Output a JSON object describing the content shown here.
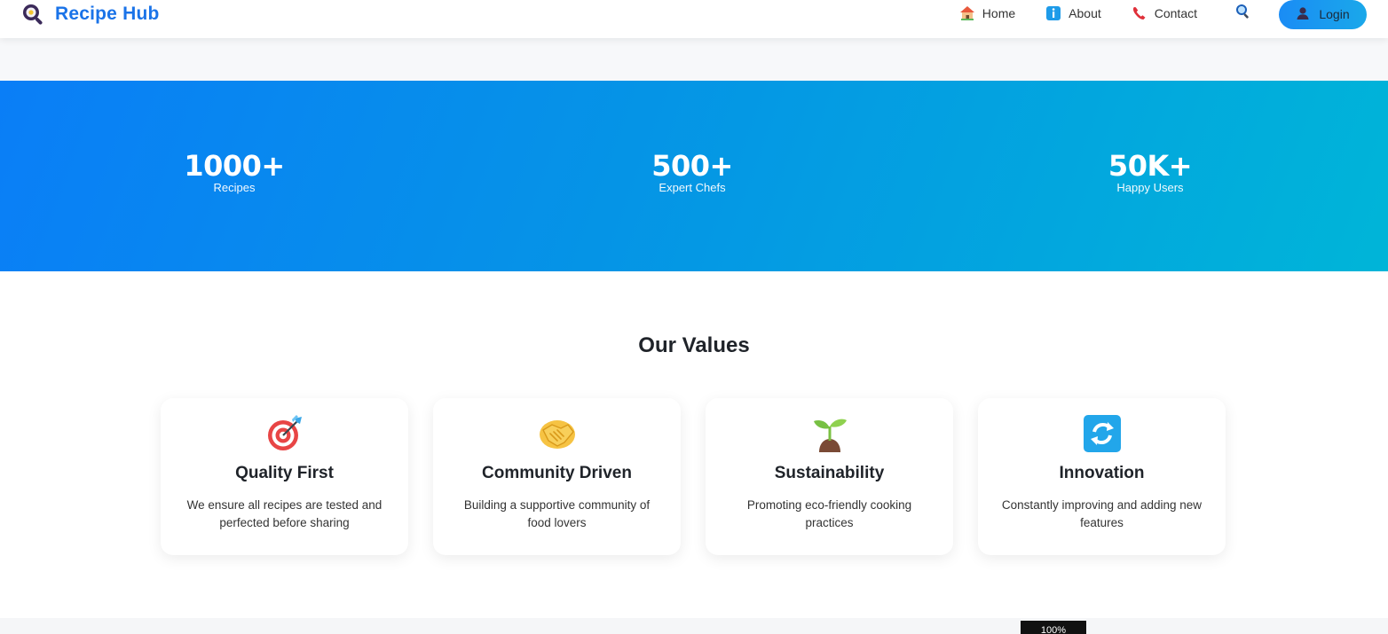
{
  "header": {
    "brand_title": "Recipe Hub",
    "nav": [
      {
        "label": "Home",
        "icon": "house-icon"
      },
      {
        "label": "About",
        "icon": "info-icon"
      },
      {
        "label": "Contact",
        "icon": "telephone-icon"
      }
    ],
    "search_icon": "magnifier-icon",
    "login_label": "Login",
    "login_icon": "user-icon"
  },
  "stats": [
    {
      "value": "1000+",
      "label": "Recipes"
    },
    {
      "value": "500+",
      "label": "Expert Chefs"
    },
    {
      "value": "50K+",
      "label": "Happy Users"
    }
  ],
  "values": {
    "title": "Our Values",
    "cards": [
      {
        "icon": "target-icon",
        "title": "Quality First",
        "desc": "We ensure all recipes are tested and perfected before sharing"
      },
      {
        "icon": "handshake-icon",
        "title": "Community Driven",
        "desc": "Building a supportive community of food lovers"
      },
      {
        "icon": "seedling-icon",
        "title": "Sustainability",
        "desc": "Promoting eco-friendly cooking practices"
      },
      {
        "icon": "refresh-icon",
        "title": "Innovation",
        "desc": "Constantly improving and adding new features"
      }
    ]
  },
  "zoom": "100%",
  "colors": {
    "brand": "#1a73e8",
    "hero_start": "#0a7ef7",
    "hero_end": "#00b5d8"
  }
}
